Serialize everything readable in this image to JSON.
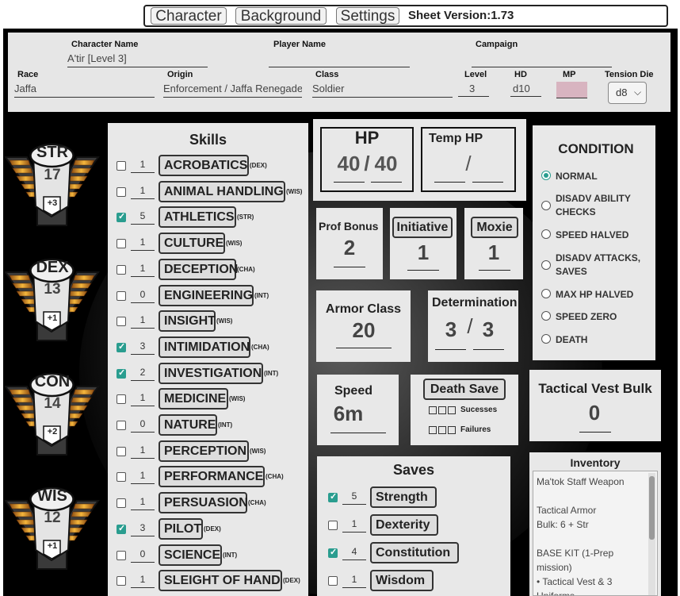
{
  "tabs": [
    {
      "label": "Character"
    },
    {
      "label": "Background"
    },
    {
      "label": "Settings"
    }
  ],
  "sheet_version": "Sheet Version:1.73",
  "header": {
    "character_name_label": "Character Name",
    "character_name": "A'tir [Level 3]",
    "player_name_label": "Player Name",
    "player_name": "",
    "campaign_label": "Campaign",
    "campaign": "",
    "race_label": "Race",
    "race": "Jaffa",
    "origin_label": "Origin",
    "origin": "Enforcement / Jaffa Renegade",
    "class_label": "Class",
    "class": "Soldier",
    "level_label": "Level",
    "level": "3",
    "hd_label": "HD",
    "hd": "d10",
    "mp_label": "MP",
    "tension_die_label": "Tension Die",
    "tension_die": "d8"
  },
  "abilities": [
    {
      "abbr": "STR",
      "score": "17",
      "mod": "+3"
    },
    {
      "abbr": "DEX",
      "score": "13",
      "mod": "+1"
    },
    {
      "abbr": "CON",
      "score": "14",
      "mod": "+2"
    },
    {
      "abbr": "WIS",
      "score": "12",
      "mod": "+1"
    }
  ],
  "skills_title": "Skills",
  "skills": [
    {
      "name": "ACROBATICS",
      "val": "1",
      "ab": "(DEX)",
      "checked": false
    },
    {
      "name": "ANIMAL HANDLING",
      "val": "1",
      "ab": "(WIS)",
      "checked": false
    },
    {
      "name": "ATHLETICS",
      "val": "5",
      "ab": "(STR)",
      "checked": true
    },
    {
      "name": "CULTURE",
      "val": "1",
      "ab": "(WIS)",
      "checked": false
    },
    {
      "name": "DECEPTION",
      "val": "1",
      "ab": "(CHA)",
      "checked": false
    },
    {
      "name": "ENGINEERING",
      "val": "0",
      "ab": "(INT)",
      "checked": false
    },
    {
      "name": "INSIGHT",
      "val": "1",
      "ab": "(WIS)",
      "checked": false
    },
    {
      "name": "INTIMIDATION",
      "val": "3",
      "ab": "(CHA)",
      "checked": true
    },
    {
      "name": "INVESTIGATION",
      "val": "2",
      "ab": "(INT)",
      "checked": true
    },
    {
      "name": "MEDICINE",
      "val": "1",
      "ab": "(WIS)",
      "checked": false
    },
    {
      "name": "NATURE",
      "val": "0",
      "ab": "(INT)",
      "checked": false
    },
    {
      "name": "PERCEPTION",
      "val": "1",
      "ab": "(WIS)",
      "checked": false
    },
    {
      "name": "PERFORMANCE",
      "val": "1",
      "ab": "(CHA)",
      "checked": false
    },
    {
      "name": "PERSUASION",
      "val": "1",
      "ab": "(CHA)",
      "checked": false
    },
    {
      "name": "PILOT",
      "val": "3",
      "ab": "(DEX)",
      "checked": true
    },
    {
      "name": "SCIENCE",
      "val": "0",
      "ab": "(INT)",
      "checked": false
    },
    {
      "name": "SLEIGHT OF HAND",
      "val": "1",
      "ab": "(DEX)",
      "checked": false
    }
  ],
  "hp": {
    "label": "HP",
    "current": "40",
    "sep": "/",
    "max": "40"
  },
  "temp_hp": {
    "label": "Temp HP",
    "sep": "/"
  },
  "prof_bonus": {
    "label": "Prof Bonus",
    "value": "2"
  },
  "initiative": {
    "label": "Initiative",
    "value": "1"
  },
  "moxie": {
    "label": "Moxie",
    "value": "1"
  },
  "armor_class": {
    "label": "Armor Class",
    "value": "20"
  },
  "determination": {
    "label": "Determination",
    "current": "3",
    "sep": "/",
    "max": "3"
  },
  "speed": {
    "label": "Speed",
    "value": "6m"
  },
  "death_save": {
    "label": "Death Save",
    "successes": "Sucesses",
    "failures": "Failures"
  },
  "condition": {
    "title": "CONDITION",
    "options": [
      "NORMAL",
      "DISADV ABILITY CHECKS",
      "SPEED HALVED",
      "DISADV ATTACKS, SAVES",
      "MAX HP HALVED",
      "SPEED ZERO",
      "DEATH"
    ],
    "selected": "NORMAL"
  },
  "vest_bulk": {
    "label": "Tactical Vest Bulk",
    "value": "0"
  },
  "inventory": {
    "title": "Inventory",
    "lines": [
      "Ma'tok Staff Weapon",
      "",
      "Tactical Armor",
      "Bulk: 6 + Str",
      "",
      "BASE KIT (1-Prep",
      "mission)",
      "• Tactical Vest & 3",
      "Uniforms"
    ]
  },
  "saves": {
    "title": "Saves",
    "items": [
      {
        "name": "Strength",
        "val": "5",
        "checked": true
      },
      {
        "name": "Dexterity",
        "val": "1",
        "checked": false
      },
      {
        "name": "Constitution",
        "val": "4",
        "checked": true
      },
      {
        "name": "Wisdom",
        "val": "1",
        "checked": false
      }
    ]
  },
  "colors": {
    "accent": "#2a9d8f",
    "panel": "#e8e8e8",
    "mp_field": "#d8b4c0"
  }
}
